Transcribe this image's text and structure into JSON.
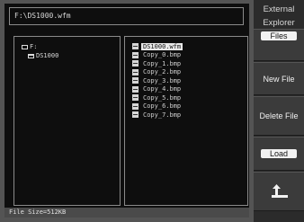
{
  "path": "F:\\DS1000.wfm",
  "tree": {
    "drive": "F:",
    "folder": "DS1000"
  },
  "files": [
    {
      "name": "DS1000.wfm",
      "selected": true
    },
    {
      "name": "Copy_0.bmp",
      "selected": false
    },
    {
      "name": "Copy_1.bmp",
      "selected": false
    },
    {
      "name": "Copy_2.bmp",
      "selected": false
    },
    {
      "name": "Copy_3.bmp",
      "selected": false
    },
    {
      "name": "Copy_4.bmp",
      "selected": false
    },
    {
      "name": "Copy_5.bmp",
      "selected": false
    },
    {
      "name": "Copy_6.bmp",
      "selected": false
    },
    {
      "name": "Copy_7.bmp",
      "selected": false
    }
  ],
  "status": "File Size=512KB",
  "sidebar": {
    "title": "External",
    "explorer_label": "Explorer",
    "explorer_value": "Files",
    "new_file": "New File",
    "delete_file": "Delete File",
    "load_value": "Load",
    "back_icon": "return-arrow-icon"
  }
}
